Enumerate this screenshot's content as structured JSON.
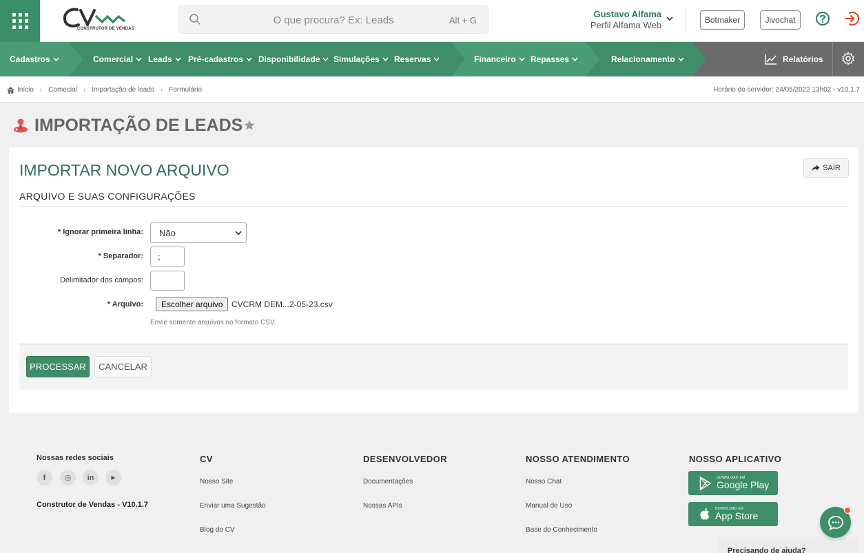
{
  "header": {
    "logo_tagline": "CONSTRUTOR DE VENDAS",
    "search_placeholder": "O que procura? Ex: Leads",
    "search_shortcut": "Alt + G",
    "user_name": "Gustavo Alfama",
    "user_profile": "Perfil Alfama Web",
    "botmaker_label": "Botmaker",
    "jivochat_label": "Jivochat"
  },
  "nav": {
    "items": [
      "Cadastros",
      "Comercial",
      "Leads",
      "Pré-cadastros",
      "Disponibilidade",
      "Simulações",
      "Reservas",
      "Financeiro",
      "Repasses",
      "Relacionamento"
    ],
    "reports_label": "Relatórios"
  },
  "breadcrumb": {
    "items": [
      "Início",
      "Comecial",
      "Importação de leads",
      "Formulário"
    ],
    "server_time": "Horário do servidor: 24/05/2022 13h02 - v10.1.7"
  },
  "page": {
    "title": "IMPORTAÇÃO DE LEADS"
  },
  "form": {
    "card_title": "IMPORTAR NOVO ARQUIVO",
    "exit_label": "SAIR",
    "section_title": "ARQUIVO E SUAS CONFIGURAÇÕES",
    "ignore_first_label": "* Ignorar primeira linha:",
    "ignore_first_value": "Não",
    "separator_label": "* Separador:",
    "separator_value": ";",
    "delimiter_label": "Delimitador dos campos:",
    "delimiter_value": "",
    "file_label": "* Arquivo:",
    "file_button": "Escolher arquivo",
    "file_name": "CVCRM DEM...2-05-23.csv",
    "file_hint": "Envie somente arquivos no formato CSV.",
    "process_label": "PROCESSAR",
    "cancel_label": "CANCELAR"
  },
  "footer": {
    "social_title": "Nossas redes sociais",
    "social_icons": [
      "f",
      "◎",
      "in",
      "▶"
    ],
    "version": "Construtor de Vendas - V10.1.7",
    "cv_title": "CV",
    "cv_links": [
      "Nosso Site",
      "Enviar uma Sugestão",
      "Blog do CV"
    ],
    "dev_title": "DESENVOLVEDOR",
    "dev_links": [
      "Documentações",
      "Nossas APIs"
    ],
    "support_title": "NOSSO ATENDIMENTO",
    "support_links": [
      "Nosso Chat",
      "Manual de Uso",
      "Base do Conhecimento"
    ],
    "app_title": "NOSSO APLICATIVO",
    "google_small": "DOWNLOAD EM",
    "google_big": "Google Play",
    "apple_small": "DOWNLOAD EM",
    "apple_big": "App Store",
    "help_prompt": "Precisando de ajuda?"
  },
  "colors": {
    "brand_green": "#3d8e69",
    "nav_green": "#4a9c76",
    "nav_gray": "#6b6b6b",
    "accent_red": "#e0411f"
  }
}
